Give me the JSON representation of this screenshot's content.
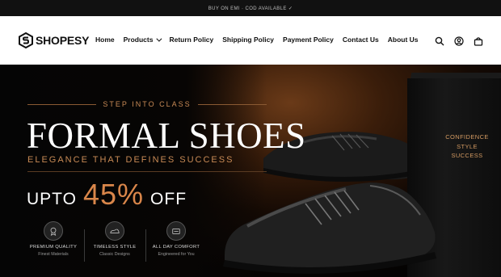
{
  "announcement": "BUY ON EMI · COD AVAILABLE ✓",
  "brand": {
    "name": "SHOPESY"
  },
  "nav": {
    "items": [
      {
        "label": "Home"
      },
      {
        "label": "Products"
      },
      {
        "label": "Return Policy"
      },
      {
        "label": "Shipping Policy"
      },
      {
        "label": "Payment Policy"
      },
      {
        "label": "Contact Us"
      },
      {
        "label": "About Us"
      }
    ]
  },
  "header_icons": [
    "search-icon",
    "account-icon",
    "cart-icon"
  ],
  "hero": {
    "kicker": "STEP INTO CLASS",
    "title": "FORMAL SHOES",
    "tagline": "ELEGANCE THAT DEFINES SUCCESS",
    "offer_prefix": "UPTO",
    "offer_value": "45%",
    "offer_suffix": "OFF",
    "box_lines": [
      "CONFIDENCE",
      "STYLE",
      "SUCCESS"
    ],
    "features": [
      {
        "icon": "quality-badge-icon",
        "title": "PREMIUM QUALITY",
        "subtitle": "Finest Materials"
      },
      {
        "icon": "shoe-icon",
        "title": "TIMELESS STYLE",
        "subtitle": "Classic Designs"
      },
      {
        "icon": "comfort-icon",
        "title": "ALL DAY COMFORT",
        "subtitle": "Engineered for You"
      }
    ]
  },
  "colors": {
    "accent": "#d9864a",
    "gold": "#c88a55",
    "header_bg": "#ffffff",
    "hero_bg": "#000000"
  }
}
